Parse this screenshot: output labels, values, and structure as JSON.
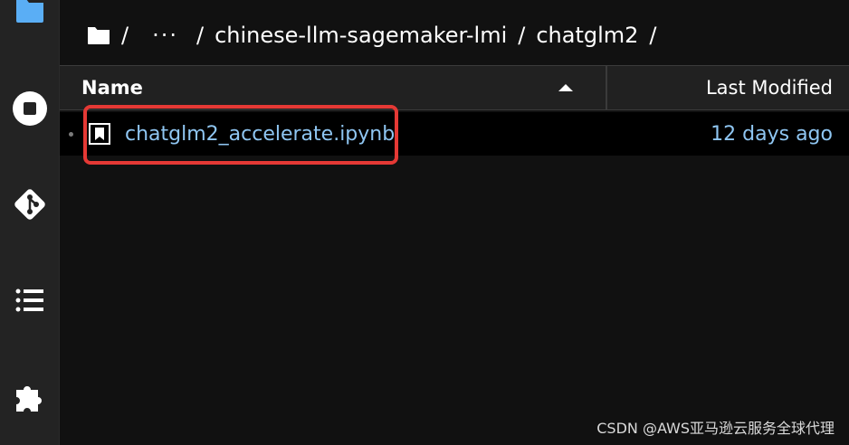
{
  "activity_bar": {
    "icons": [
      "folder-icon",
      "stop-icon",
      "git-icon",
      "table-of-contents-icon",
      "extension-icon"
    ]
  },
  "breadcrumb": {
    "sep": "/",
    "ellipsis": "···",
    "items": [
      "chinese-llm-sagemaker-lmi",
      "chatglm2"
    ]
  },
  "file_browser": {
    "columns": {
      "name": "Name",
      "last_modified": "Last Modified"
    },
    "sort": {
      "column": "Name",
      "direction": "ascending"
    },
    "rows": [
      {
        "name": "chatglm2_accelerate.ipynb",
        "modified": "12 days ago",
        "icon": "notebook-icon"
      }
    ]
  },
  "colors": {
    "accent": "#8fc6f2",
    "highlight": "#e53935",
    "background": "#111111",
    "sidebar": "#232323"
  },
  "watermark": "CSDN @AWS亚马逊云服务全球代理"
}
